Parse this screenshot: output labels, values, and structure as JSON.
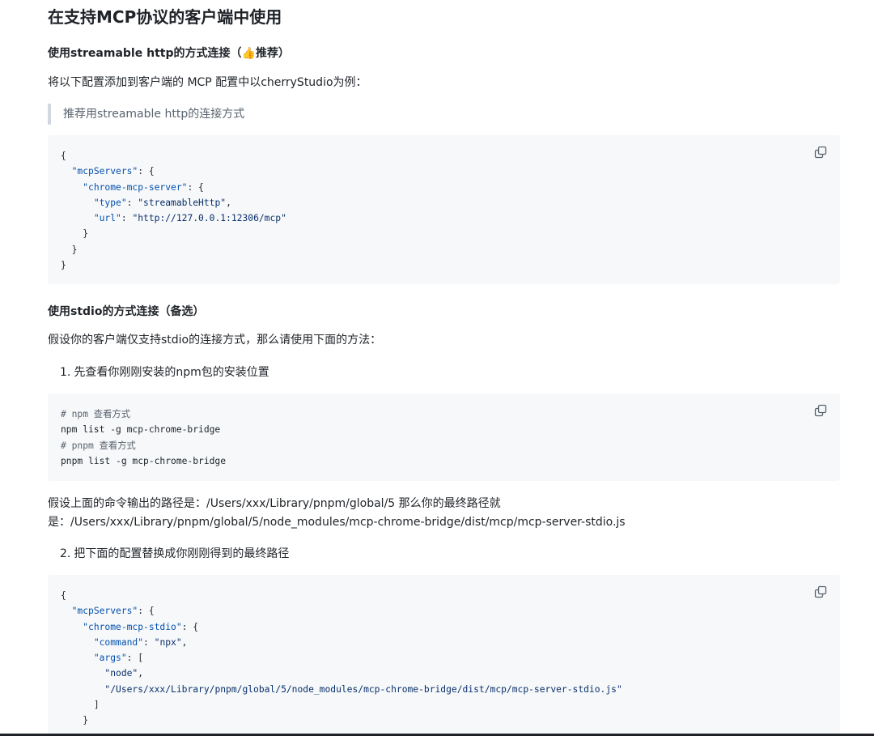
{
  "title": "在支持MCP协议的客户端中使用",
  "section1": {
    "heading": "使用streamable http的方式连接（👍推荐）",
    "intro": "将以下配置添加到客户端的 MCP 配置中以cherryStudio为例：",
    "quote": "推荐用streamable http的连接方式",
    "code": {
      "open": "{",
      "mcp_key": "\"mcpServers\"",
      "server_key": "\"chrome-mcp-server\"",
      "type_key": "\"type\"",
      "type_val": "\"streamableHttp\"",
      "url_key": "\"url\"",
      "url_val": "\"http://127.0.0.1:12306/mcp\"",
      "close": "}"
    }
  },
  "section2": {
    "heading": "使用stdio的方式连接（备选）",
    "intro": "假设你的客户端仅支持stdio的连接方式，那么请使用下面的方法：",
    "step1": {
      "num": "1.",
      "text": "先查看你刚刚安装的npm包的安装位置"
    },
    "shell": {
      "c1": "# npm 查看方式",
      "l1": "npm list -g mcp-chrome-bridge",
      "c2": "# pnpm 查看方式",
      "l2": "pnpm list -g mcp-chrome-bridge"
    },
    "path_line1": "假设上面的命令输出的路径是：/Users/xxx/Library/pnpm/global/5 那么你的最终路径就",
    "path_line2": "是：/Users/xxx/Library/pnpm/global/5/node_modules/mcp-chrome-bridge/dist/mcp/mcp-server-stdio.js",
    "step2": {
      "num": "2.",
      "text": "把下面的配置替换成你刚刚得到的最终路径"
    },
    "code": {
      "open": "{",
      "mcp_key": "\"mcpServers\"",
      "server_key": "\"chrome-mcp-stdio\"",
      "cmd_key": "\"command\"",
      "cmd_val": "\"npx\"",
      "args_key": "\"args\"",
      "arg1": "\"node\"",
      "arg2": "\"/Users/xxx/Library/pnpm/global/5/node_modules/mcp-chrome-bridge/dist/mcp/mcp-server-stdio.js\"",
      "bracket_close": "]",
      "close": "}"
    }
  },
  "icons": {
    "copy": "copy-icon"
  }
}
